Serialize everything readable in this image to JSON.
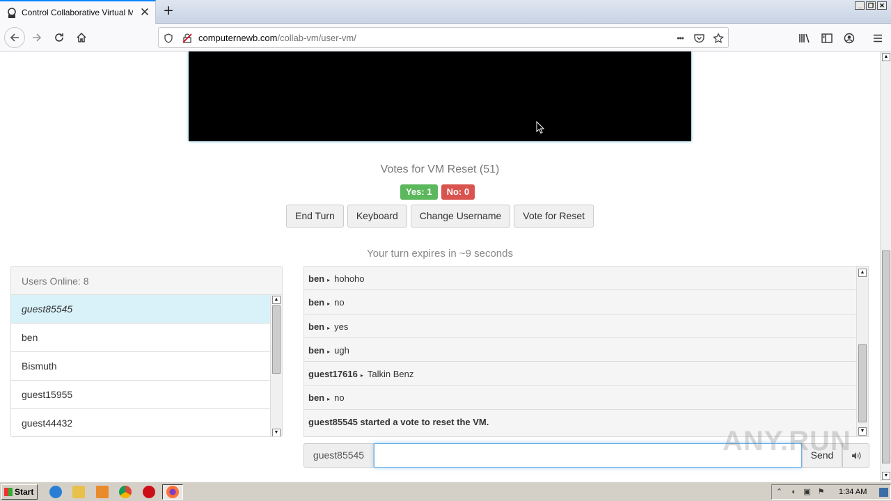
{
  "browser": {
    "tab_title": "Control Collaborative Virtual Machi",
    "url_host": "computernewb.com",
    "url_path": "/collab-vm/user-vm/",
    "more_label": "•••"
  },
  "vm": {
    "vote_title": "Votes for VM Reset (51)",
    "yes_label": "Yes: 1",
    "no_label": "No: 0",
    "votes_yes": 1,
    "votes_no": 0,
    "buttons": [
      "End Turn",
      "Keyboard",
      "Change Username",
      "Vote for Reset"
    ],
    "turn_text": "Your turn expires in ~9 seconds"
  },
  "users": {
    "header": "Users Online: 8",
    "list": [
      "guest85545",
      "ben",
      "Bismuth",
      "guest15955",
      "guest44432"
    ]
  },
  "chat": {
    "messages": [
      {
        "who": "ben",
        "text": "hohoho"
      },
      {
        "who": "ben",
        "text": "no"
      },
      {
        "who": "ben",
        "text": "yes"
      },
      {
        "who": "ben",
        "text": "ugh"
      },
      {
        "who": "guest17616",
        "text": "Talkin Benz"
      },
      {
        "who": "ben",
        "text": "no"
      }
    ],
    "system_message": "guest85545 started a vote to reset the VM.",
    "username": "guest85545",
    "input_value": "",
    "send_label": "Send"
  },
  "watermark": "ANY.RUN",
  "taskbar": {
    "start_label": "Start",
    "clock": "1:34 AM"
  },
  "colors": {
    "accent": "#0a84ff",
    "yes": "#5cb85c",
    "no": "#d9534f",
    "highlight": "#d9f2fa"
  }
}
